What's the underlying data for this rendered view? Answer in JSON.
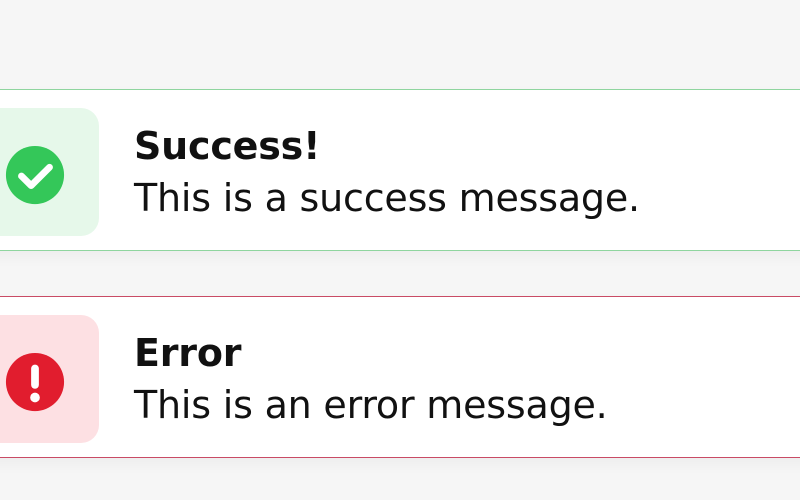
{
  "notifications": [
    {
      "type": "success",
      "icon": "check-circle-icon",
      "title": "Success!",
      "message": "This is a success message.",
      "colors": {
        "accent": "#34c759",
        "icon_bg": "#e6f8ea",
        "border": "#8fd59f"
      }
    },
    {
      "type": "error",
      "icon": "exclamation-circle-icon",
      "title": "Error",
      "message": "This is an error message.",
      "colors": {
        "accent": "#e11d2e",
        "icon_bg": "#fde0e3",
        "border": "#c94b65"
      }
    }
  ]
}
